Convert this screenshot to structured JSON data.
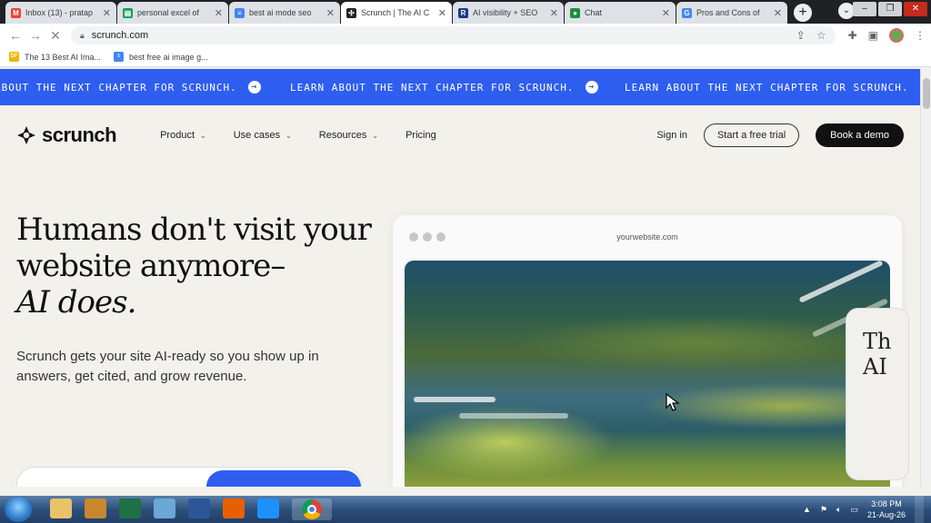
{
  "browser": {
    "tabs": [
      {
        "title": "Inbox (13) - pratap",
        "favicon": "gmail-icon",
        "color": "#ea4335",
        "glyph": "M"
      },
      {
        "title": "personal excel of",
        "favicon": "sheets-icon",
        "color": "#0f9d58",
        "glyph": "▤"
      },
      {
        "title": "best ai mode seo",
        "favicon": "docs-icon",
        "color": "#4285f4",
        "glyph": "≡"
      },
      {
        "title": "Scrunch | The AI C",
        "favicon": "scrunch-icon",
        "color": "#222222",
        "glyph": "✣",
        "active": true
      },
      {
        "title": "AI visibility + SEO",
        "favicon": "r-icon",
        "color": "#1a3a8a",
        "glyph": "R"
      },
      {
        "title": "Chat",
        "favicon": "chat-icon",
        "color": "#1e8e3e",
        "glyph": "●"
      },
      {
        "title": "Pros and Cons of",
        "favicon": "google-icon",
        "color": "#4285f4",
        "glyph": "G"
      }
    ],
    "url": "scrunch.com",
    "bookmarks": [
      {
        "label": "The 13 Best AI Ima...",
        "icon": "bookmark-site-icon",
        "color": "#f4b400",
        "glyph": "DF"
      },
      {
        "label": "best free ai image g...",
        "icon": "docs-icon",
        "color": "#4285f4",
        "glyph": "≡"
      }
    ]
  },
  "page": {
    "marquee_text": "LEARN ABOUT THE NEXT CHAPTER FOR SCRUNCH.",
    "marquee_partial": "ABOUT THE NEXT CHAPTER FOR SCRUNCH.",
    "accent_color": "#2e5ef0",
    "logo_text": "scrunch",
    "nav": {
      "items": [
        {
          "label": "Product",
          "dropdown": true
        },
        {
          "label": "Use cases",
          "dropdown": true
        },
        {
          "label": "Resources",
          "dropdown": true
        },
        {
          "label": "Pricing",
          "dropdown": false
        }
      ],
      "sign_in": "Sign in",
      "free_trial": "Start a free trial",
      "book_demo": "Book a demo"
    },
    "hero": {
      "title_line1": "Humans don't visit your",
      "title_line2": "website anymore–",
      "title_line3": "AI does.",
      "subtitle": "Scrunch gets your site AI-ready so you show up in answers, get cited, and grow revenue."
    },
    "preview": {
      "url": "yourwebsite.com",
      "overlay_text_1": "Th",
      "overlay_text_2": "AI"
    }
  },
  "taskbar": {
    "icons": [
      "explorer-icon",
      "media-player-icon",
      "excel-icon",
      "notepad-icon",
      "word-icon",
      "firefox-icon",
      "ie-icon",
      "chrome-icon"
    ],
    "time": "3:08 PM",
    "date": "21-Aug-26"
  }
}
